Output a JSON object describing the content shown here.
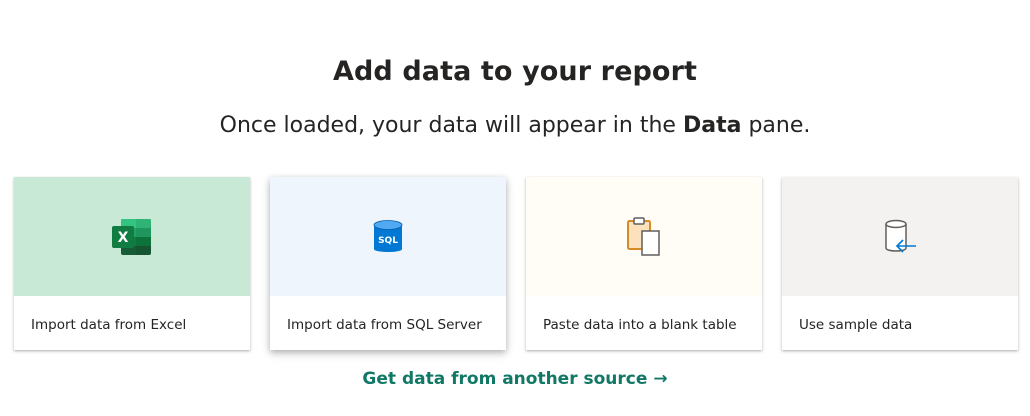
{
  "header": {
    "title": "Add data to your report",
    "subtitle_prefix": "Once loaded, your data will appear in the ",
    "subtitle_bold": "Data",
    "subtitle_suffix": " pane."
  },
  "cards": [
    {
      "label": "Import data from Excel",
      "icon": "excel-icon",
      "bg": "#c8e9d6"
    },
    {
      "label": "Import data from SQL Server",
      "icon": "sql-database-icon",
      "bg": "#eef5fd"
    },
    {
      "label": "Paste data into a blank table",
      "icon": "paste-icon",
      "bg": "#fffdf5"
    },
    {
      "label": "Use sample data",
      "icon": "sample-data-icon",
      "bg": "#f3f2f1"
    }
  ],
  "link": {
    "text": "Get data from another source →"
  },
  "colors": {
    "accent_link": "#117865",
    "excel_green": "#107c41",
    "sql_blue": "#0078d4",
    "paste_orange": "#d68b25"
  }
}
